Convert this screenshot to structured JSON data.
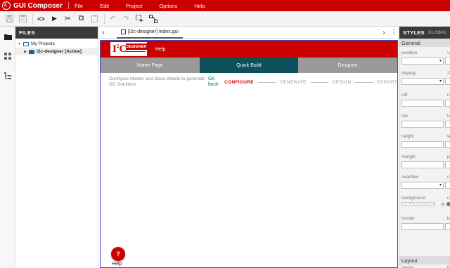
{
  "app": {
    "title": "GUI Composer",
    "menu": [
      "File",
      "Edit",
      "Project",
      "Options",
      "Help"
    ],
    "brand_color": "#cc0000"
  },
  "toolbar": {
    "icons": [
      "save-icon",
      "save-all-icon",
      "code-view-icon",
      "run-icon",
      "cut-icon",
      "copy-icon",
      "paste-icon",
      "undo-icon",
      "redo-icon",
      "select-tool-icon",
      "connect-tool-icon"
    ],
    "glyphs": {
      "save": "💾",
      "save_all": "🗎",
      "code": "<>",
      "run": "▶",
      "cut": "✂",
      "copy": "⧉",
      "paste": "📋",
      "undo": "↶",
      "redo": "↷",
      "select": "⬚",
      "connect": "⬚"
    }
  },
  "activity": {
    "icons": [
      "folder-icon",
      "components-icon",
      "hierarchy-icon"
    ],
    "glyphs": {
      "folder": "▆",
      "components": "⊞",
      "hierarchy": "⋮"
    }
  },
  "files": {
    "header": "FILES",
    "root": "My Projects",
    "project": "i2c-designer [Active]",
    "arrow": "▶"
  },
  "editor": {
    "tab_label": "[i2c-designer] index.gui",
    "nav_prev": "‹",
    "nav_next": "›",
    "more": "⋮"
  },
  "i2c_app": {
    "logo_big": "I",
    "logo_sup": "2",
    "logo_c": "C",
    "logo_tag": "DESIGNER",
    "help_link": "Help",
    "tabs": [
      "Home Page",
      "Quick Build",
      "Designer"
    ],
    "active_tab": "Quick Build",
    "configure_text": "Configure Master and Slave details to generate I2C Solutions",
    "go_back": "Go back",
    "steps": [
      "CONFIGURE",
      "GENERATE",
      "DESIGN",
      "EXPORT"
    ],
    "current_step": "CONFIGURE",
    "help_fab": "?",
    "help_label": "Help"
  },
  "styles_panel": {
    "header": "STYLES",
    "header_sub": "GLOBAL",
    "general_title": "General",
    "layout_title": "Layout",
    "props": [
      {
        "label": "position",
        "label2": "v"
      },
      {
        "label": "display",
        "label2": "z"
      },
      {
        "label": "left",
        "label2": "ri"
      },
      {
        "label": "top",
        "label2": "b"
      },
      {
        "label": "height",
        "label2": "w"
      },
      {
        "label": "margin",
        "label2": "p"
      },
      {
        "label": "overflow",
        "label2": "c"
      },
      {
        "label": "background",
        "label2": "c"
      },
      {
        "label": "border",
        "label2": "b"
      },
      {
        "label": "layout",
        "label2": "fl"
      }
    ],
    "dropdown_arrow": "▾"
  }
}
